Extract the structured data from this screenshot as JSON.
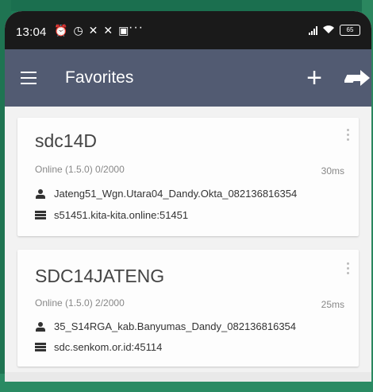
{
  "status_bar": {
    "time": "13:04",
    "battery": "65",
    "overflow_dots": "···"
  },
  "app_bar": {
    "title": "Favorites",
    "add_label": "+"
  },
  "servers": [
    {
      "name": "sdc14D",
      "status": "Online (1.5.0)  0/2000",
      "ping": "30ms",
      "owner": "Jateng51_Wgn.Utara04_Dandy.Okta_082136816354",
      "address": "s51451.kita-kita.online:51451"
    },
    {
      "name": "SDC14JATENG",
      "status": "Online (1.5.0)  2/2000",
      "ping": "25ms",
      "owner": "35_S14RGA_kab.Banyumas_Dandy_082136816354",
      "address": "sdc.senkom.or.id:45114"
    }
  ],
  "colors": {
    "app_bar": "#525b72",
    "status_bar": "#1a1a1a",
    "background": "#f2f2f2",
    "card": "#fdfdfd"
  },
  "icons": {
    "menu": "hamburger-icon",
    "add": "plus-icon",
    "login": "arrow-right-icon",
    "owner": "person-icon",
    "address": "server-icon",
    "more": "more-vertical-icon"
  }
}
